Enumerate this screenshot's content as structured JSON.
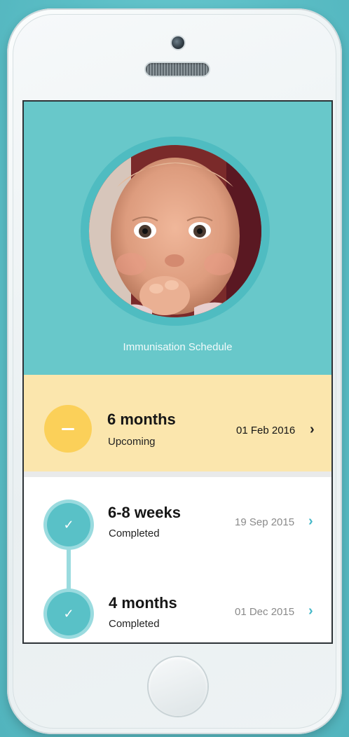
{
  "colors": {
    "accent": "#68c8ca",
    "upcoming_bg": "#fbe6ad",
    "upcoming_badge": "#fbd059",
    "completed_badge": "#59c1c7",
    "chevron_active": "#45b8c8"
  },
  "header": {
    "title": "Immunisation Schedule",
    "avatar": "baby-photo"
  },
  "schedule": [
    {
      "title": "6 months",
      "status": "Upcoming",
      "date": "01 Feb 2016",
      "icon": "minus-icon"
    },
    {
      "title": "6-8 weeks",
      "status": "Completed",
      "date": "19 Sep 2015",
      "icon": "check-icon"
    },
    {
      "title": "4 months",
      "status": "Completed",
      "date": "01 Dec 2015",
      "icon": "check-icon"
    }
  ]
}
